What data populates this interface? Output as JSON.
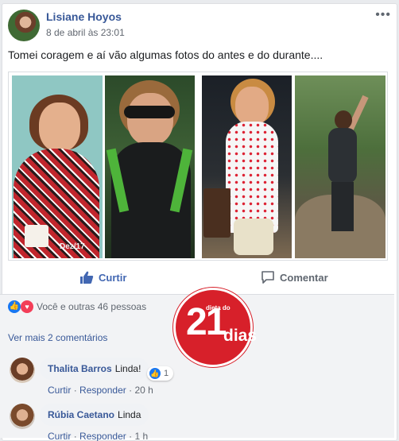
{
  "post": {
    "author": "Lisiane Hoyos",
    "timestamp": "8 de abril às 23:01",
    "more_glyph": "•••",
    "text": "Tomei coragem e aí vão algumas fotos do antes e do durante....",
    "photo_stamp": "Dez/17"
  },
  "actions": {
    "like_label": "Curtir",
    "comment_label": "Comentar"
  },
  "reactions": {
    "summary": "Você e outras 46 pessoas"
  },
  "comments": {
    "more_label": "Ver mais 2 comentários",
    "items": [
      {
        "name": "Thalita Barros",
        "text": "Linda!",
        "reaction_count": "1",
        "like": "Curtir",
        "separator": "·",
        "reply": "Responder",
        "age": "20 h"
      },
      {
        "name": "Rúbia Caetano",
        "text": "Linda",
        "like": "Curtir",
        "separator": "·",
        "reply": "Responder",
        "age": "1 h"
      }
    ]
  },
  "badge": {
    "small": "dieta do",
    "number": "21",
    "word": "dias",
    "color": "#d7202a"
  },
  "colors": {
    "link": "#385898",
    "like_blue": "#4267b2",
    "love_red": "#f33e58"
  }
}
